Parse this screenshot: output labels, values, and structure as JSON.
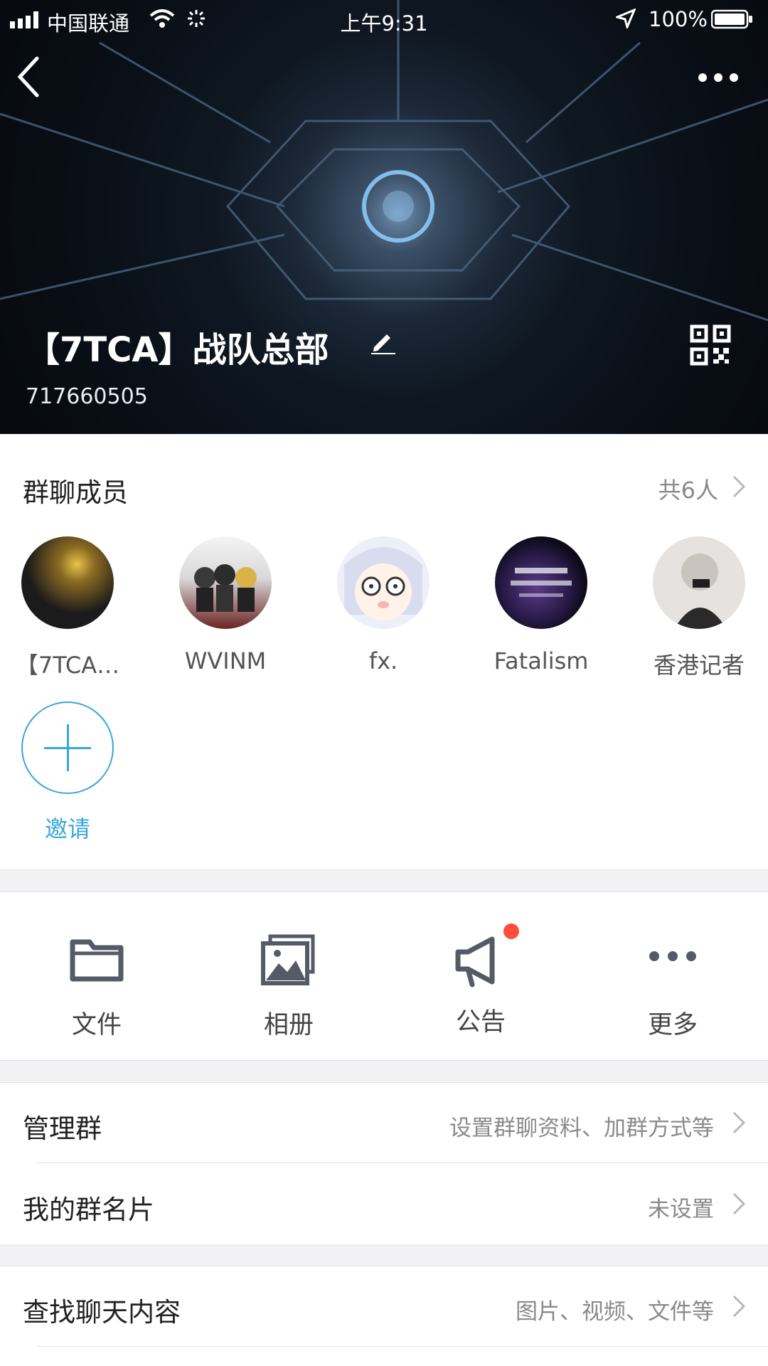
{
  "status_bar": {
    "carrier": "中国联通",
    "time": "上午9:31",
    "battery": "100%"
  },
  "header": {
    "group_name": "【7TCA】战队总部",
    "group_id": "717660505"
  },
  "members": {
    "title": "群聊成员",
    "count": "共6人",
    "list": [
      {
        "name": "【7TCA…"
      },
      {
        "name": "WVINM"
      },
      {
        "name": "fx."
      },
      {
        "name": "Fatalism"
      },
      {
        "name": "香港记者"
      }
    ],
    "invite_label": "邀请"
  },
  "tools": [
    {
      "label": "文件",
      "icon": "folder-icon"
    },
    {
      "label": "相册",
      "icon": "album-icon"
    },
    {
      "label": "公告",
      "icon": "megaphone-icon",
      "badge": true
    },
    {
      "label": "更多",
      "icon": "more-icon"
    }
  ],
  "settings": [
    {
      "title": "管理群",
      "value": "设置群聊资料、加群方式等"
    },
    {
      "title": "我的群名片",
      "value": "未设置"
    },
    {
      "title": "查找聊天内容",
      "value": "图片、视频、文件等"
    }
  ],
  "colors": {
    "accent": "#3aa6d9",
    "badge": "#ff4f3a",
    "separator": "#f2f2f4"
  }
}
